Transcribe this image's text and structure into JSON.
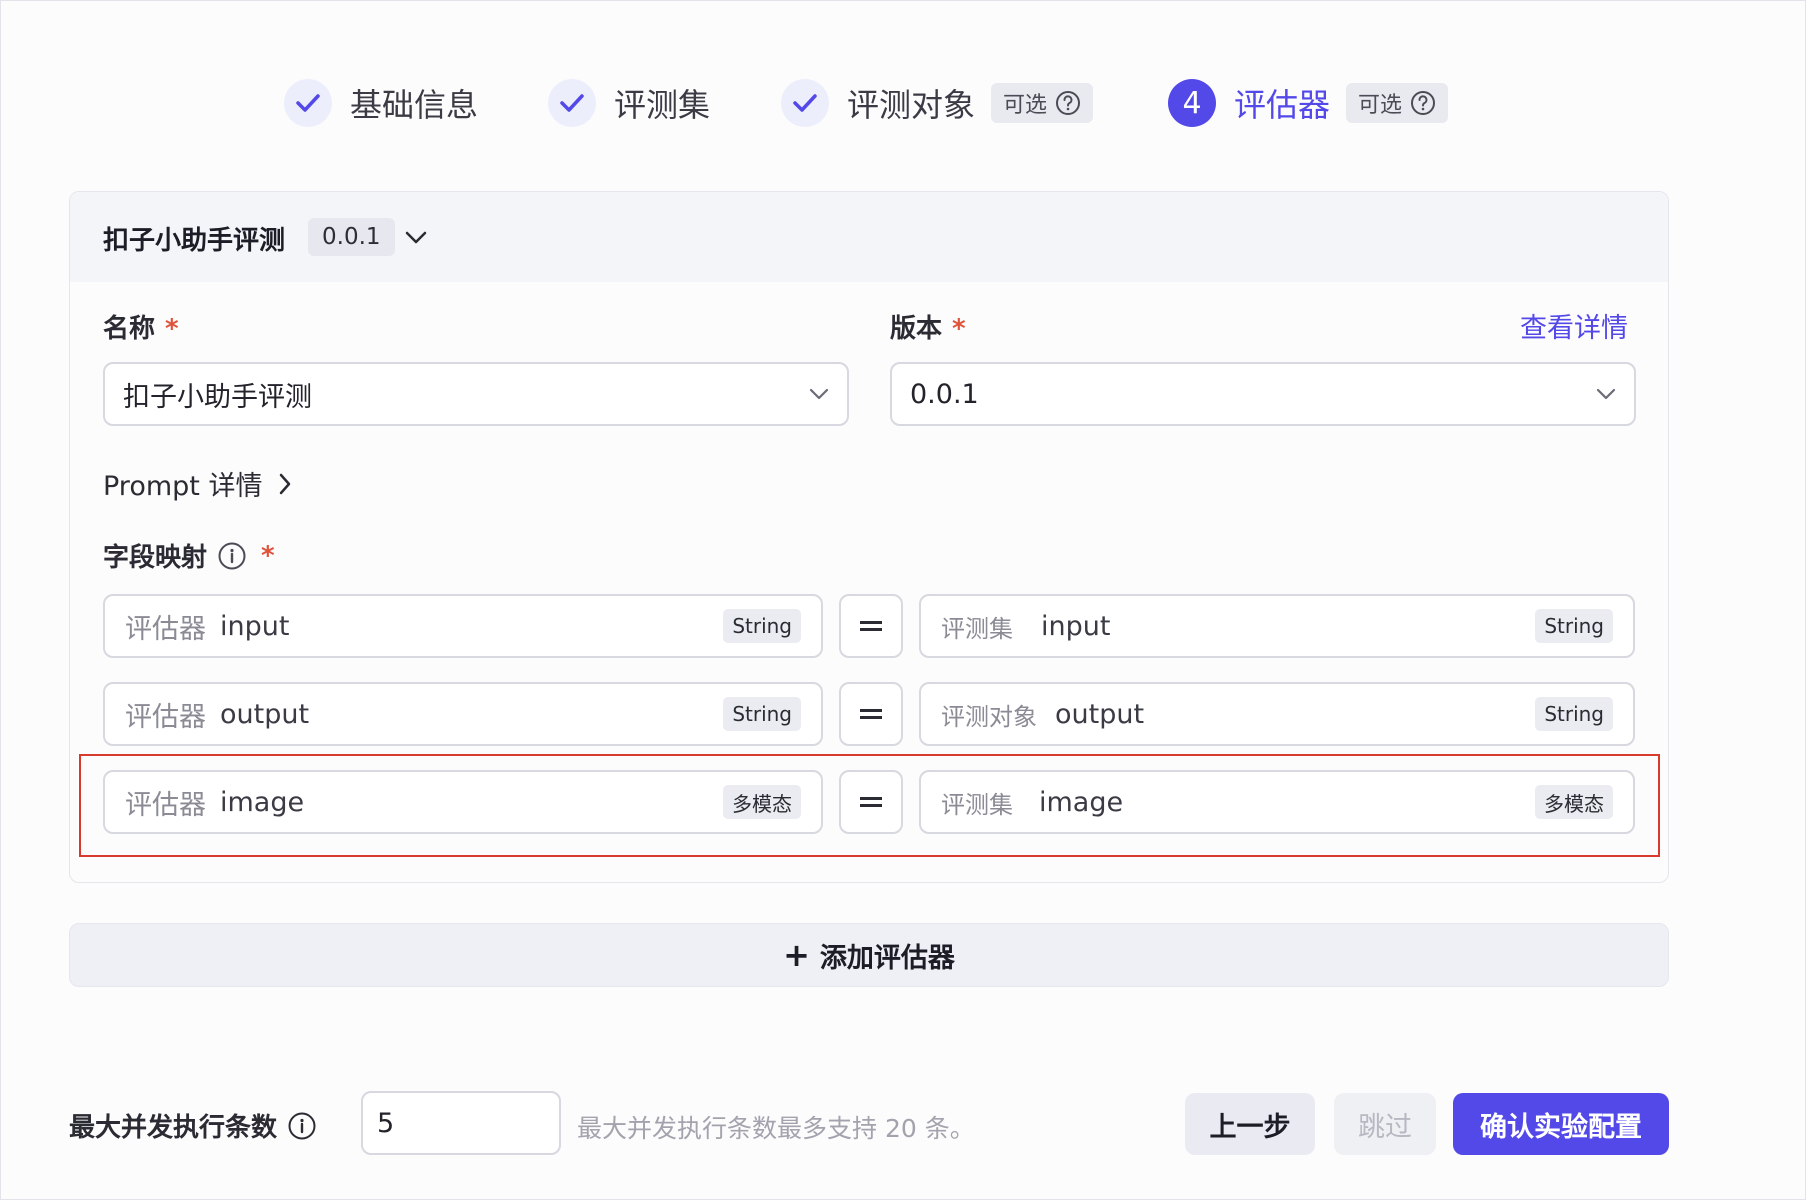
{
  "steps": [
    {
      "label": "基础信息",
      "status": "done"
    },
    {
      "label": "评测集",
      "status": "done"
    },
    {
      "label": "评测对象",
      "status": "done",
      "badge": "可选"
    },
    {
      "label": "评估器",
      "status": "active",
      "number": "4",
      "badge": "可选"
    }
  ],
  "card": {
    "title": "扣子小助手评测",
    "version_tag": "0.0.1",
    "name_label": "名称",
    "name_value": "扣子小助手评测",
    "version_label": "版本",
    "version_value": "0.0.1",
    "view_details": "查看详情",
    "required_mark": "*",
    "prompt_details": "Prompt 详情",
    "mapping_label": "字段映射",
    "mappings": [
      {
        "left_prefix": "评估器",
        "left_field": "input",
        "left_type": "String",
        "right_prefix": "评测集",
        "right_field": "input",
        "right_type": "String"
      },
      {
        "left_prefix": "评估器",
        "left_field": "output",
        "left_type": "String",
        "right_prefix": "评测对象",
        "right_field": "output",
        "right_type": "String"
      },
      {
        "left_prefix": "评估器",
        "left_field": "image",
        "left_type": "多模态",
        "right_prefix": "评测集",
        "right_field": "image",
        "right_type": "多模态"
      }
    ]
  },
  "add_evaluator": "添加评估器",
  "footer": {
    "concurrency_label": "最大并发执行条数",
    "concurrency_value": "5",
    "concurrency_hint": "最大并发执行条数最多支持 20 条。",
    "prev_button": "上一步",
    "skip_button": "跳过",
    "confirm_button": "确认实验配置"
  },
  "colors": {
    "accent": "#5348e8",
    "required": "#e0533b",
    "highlight": "#d93a2e"
  }
}
